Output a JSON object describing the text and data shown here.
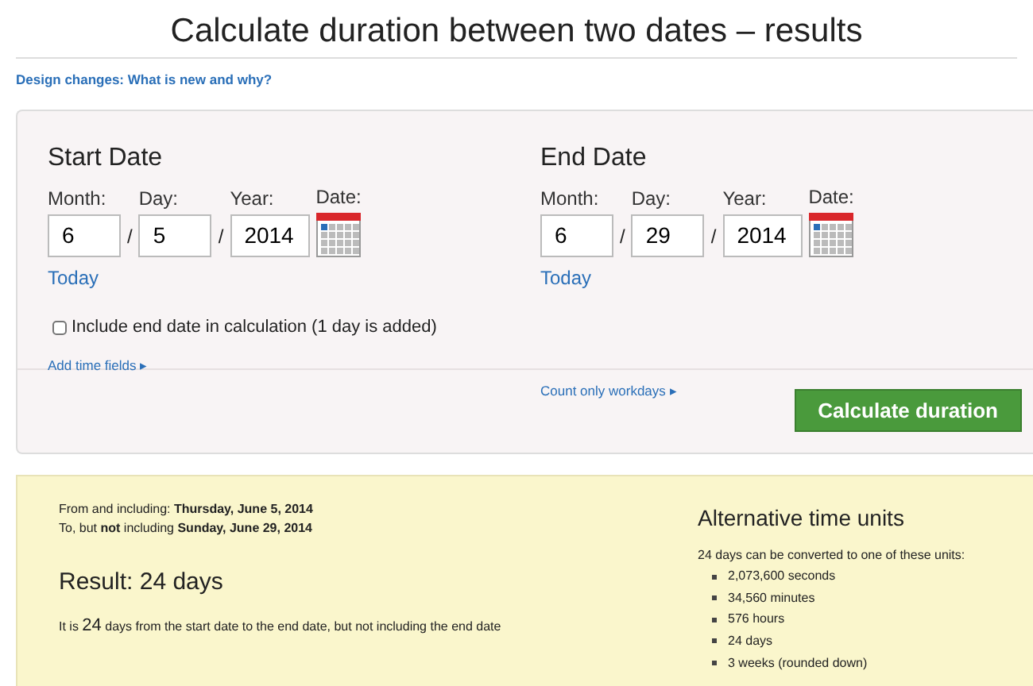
{
  "page_title": "Calculate duration between two dates – results",
  "top_link": "Design changes: What is new and why?",
  "form": {
    "dates": [
      {
        "heading": "Start Date",
        "fields": [
          {
            "label": "Month:",
            "value": "6"
          },
          {
            "label": "Day:",
            "value": "5"
          },
          {
            "label": "Year:",
            "value": "2014"
          }
        ],
        "separator": "/",
        "calendar_label": "Date:",
        "today_link": "Today"
      },
      {
        "heading": "End Date",
        "fields": [
          {
            "label": "Month:",
            "value": "6"
          },
          {
            "label": "Day:",
            "value": "29"
          },
          {
            "label": "Year:",
            "value": "2014"
          }
        ],
        "separator": "/",
        "calendar_label": "Date:",
        "today_link": "Today"
      }
    ],
    "include_end_date": {
      "label": "Include end date in calculation (1 day is added)",
      "checked": false
    },
    "option_links": [
      {
        "label": "Add time fields",
        "arrow": "▸"
      },
      {
        "label": "Count only workdays",
        "arrow": "▸"
      }
    ],
    "submit_button": "Calculate duration"
  },
  "results": {
    "from_line": "From and including: **Thursday, June 5, 2014**",
    "to_line": "To, but **not** including **Sunday, June 29, 2014**",
    "result_heading": "Result: 24 days",
    "result_sentence": {
      "before": "It is ",
      "number": "24",
      "after": " days from the start date to the end date, but not including the end date"
    },
    "alternative": {
      "heading": "Alternative time units",
      "intro": "24 days can be converted to one of these units:",
      "units": [
        "2,073,600 seconds",
        "34,560 minutes",
        "576 hours",
        "24 days",
        "3 weeks (rounded down)"
      ]
    }
  }
}
